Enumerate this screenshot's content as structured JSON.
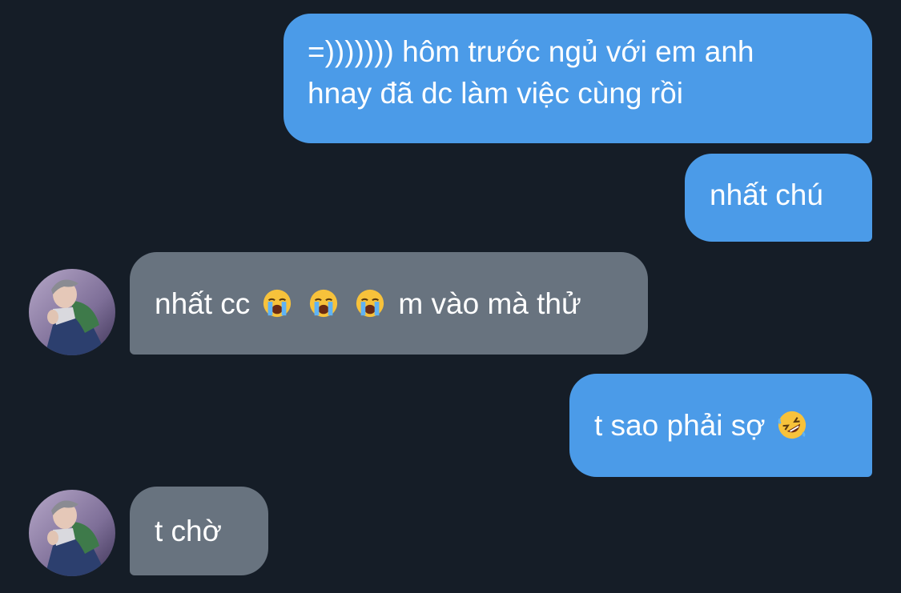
{
  "colors": {
    "background": "#151d27",
    "outgoing_bubble": "#4b9be8",
    "incoming_bubble": "#68737f"
  },
  "messages": [
    {
      "direction": "outgoing",
      "lines": [
        "=))))))) hôm trước ngủ với em anh",
        "hnay đã dc làm việc cùng rồi"
      ]
    },
    {
      "direction": "outgoing",
      "text": "nhất chú"
    },
    {
      "direction": "incoming",
      "text_before": "nhất cc",
      "emojis": [
        "loudly-crying-face-icon",
        "loudly-crying-face-icon",
        "loudly-crying-face-icon"
      ],
      "text_after": "m vào mà thử"
    },
    {
      "direction": "outgoing",
      "text": "t sao phải sợ",
      "emoji": "rolling-on-floor-laughing-icon"
    },
    {
      "direction": "incoming",
      "text": "t chờ"
    }
  ]
}
